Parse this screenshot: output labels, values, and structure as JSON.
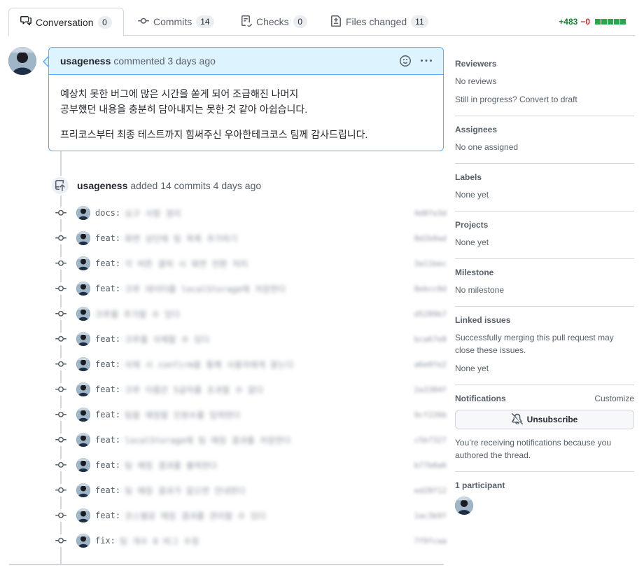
{
  "tabs": [
    {
      "label": "Conversation",
      "count": "0"
    },
    {
      "label": "Commits",
      "count": "14"
    },
    {
      "label": "Checks",
      "count": "0"
    },
    {
      "label": "Files changed",
      "count": "11"
    }
  ],
  "diffstat": {
    "additions": "+483",
    "deletions": "−0"
  },
  "comment": {
    "author": "usageness",
    "action": "commented 3 days ago",
    "lines": [
      "예상치 못한 버그에 많은 시간을 쏟게 되어 조급해진 나머지",
      "공부했던 내용을 충분히 담아내지는 못한 것 같아 아쉽습니다.",
      "프리코스부터 최종 테스트까지 힘써주신 우아한테크코스 팀께 감사드립니다."
    ]
  },
  "commit_event": {
    "author": "usageness",
    "action": "added 14 commits 4 days ago"
  },
  "commits": [
    {
      "prefix": "docs:",
      "message": "요구 사항 정리",
      "sha": "4d8fe3d"
    },
    {
      "prefix": "feat:",
      "message": "화면 상단에 팀 목록 추가하기",
      "sha": "8d2b9ad"
    },
    {
      "prefix": "feat:",
      "message": "각 버튼 클릭 시 화면 전환 처리",
      "sha": "3a11bec"
    },
    {
      "prefix": "feat:",
      "message": "크루 데이터를 localStorage에 저장한다",
      "sha": "8ebcc0d"
    },
    {
      "prefix": "",
      "message": "크루를 추가할 수 있다",
      "sha": "d5289b7"
    },
    {
      "prefix": "feat:",
      "message": "크루를 삭제할 수 있다",
      "sha": "bca67e8"
    },
    {
      "prefix": "feat:",
      "message": "삭제 시 confirm을 통해 사용자에게 묻는다",
      "sha": "a6e0fe2"
    },
    {
      "prefix": "feat:",
      "message": "크루 이름은 5글자를 초과할 수 없다",
      "sha": "2a3384f"
    },
    {
      "prefix": "feat:",
      "message": "팀을 매칭할 인원수를 입력한다",
      "sha": "9cf226b"
    },
    {
      "prefix": "feat:",
      "message": "localStorage에 팀 매칭 결과를 저장한다",
      "sha": "c5b7327"
    },
    {
      "prefix": "feat:",
      "message": "팀 매칭 결과를 출력한다",
      "sha": "b77b0a6"
    },
    {
      "prefix": "feat:",
      "message": "팀 매칭 결과가 없으면 안내한다",
      "sha": "ed28f12"
    },
    {
      "prefix": "feat:",
      "message": "코스별로 매칭 결과를 관리할 수 있다",
      "sha": "1ac3b9f"
    },
    {
      "prefix": "fix:",
      "message": "팀 개수 0 버그 수정",
      "sha": "7f9fcaa"
    }
  ],
  "sidebar": {
    "reviewers": {
      "heading": "Reviewers",
      "text": "No reviews",
      "hint": "Still in progress? Convert to draft"
    },
    "assignees": {
      "heading": "Assignees",
      "text": "No one assigned"
    },
    "labels": {
      "heading": "Labels",
      "text": "None yet"
    },
    "projects": {
      "heading": "Projects",
      "text": "None yet"
    },
    "milestone": {
      "heading": "Milestone",
      "text": "No milestone"
    },
    "linked": {
      "heading": "Linked issues",
      "text": "Successfully merging this pull request may close these issues.",
      "value": "None yet"
    },
    "notifications": {
      "heading": "Notifications",
      "customize": "Customize",
      "button": "Unsubscribe",
      "text": "You’re receiving notifications because you authored the thread."
    },
    "participants": {
      "heading": "1 participant"
    }
  },
  "colors": {
    "accent": "#54aeff",
    "header_bg": "#ddf4ff",
    "add": "#1a7f37",
    "del": "#cf222e"
  },
  "icons": [
    "conversation-icon",
    "commit-icon",
    "checklist-icon",
    "file-diff-icon",
    "smiley-icon",
    "kebab-icon",
    "repo-push-icon",
    "bell-slash-icon"
  ]
}
